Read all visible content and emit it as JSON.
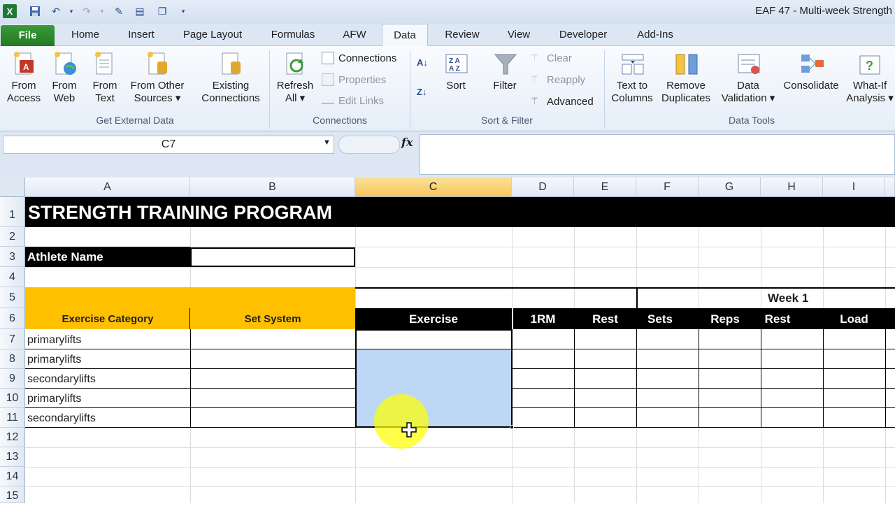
{
  "window": {
    "title": "EAF 47 - Multi-week Strength"
  },
  "tabs": [
    "File",
    "Home",
    "Insert",
    "Page Layout",
    "Formulas",
    "AFW",
    "Data",
    "Review",
    "View",
    "Developer",
    "Add-Ins"
  ],
  "active_tab": "Data",
  "ribbon": {
    "get_external_data": {
      "label": "Get External Data",
      "from_access": [
        "From",
        "Access"
      ],
      "from_web": [
        "From",
        "Web"
      ],
      "from_text": [
        "From",
        "Text"
      ],
      "from_other": [
        "From Other",
        "Sources ▾"
      ],
      "existing": [
        "Existing",
        "Connections"
      ]
    },
    "connections": {
      "label": "Connections",
      "refresh": [
        "Refresh",
        "All ▾"
      ],
      "connections": "Connections",
      "properties": "Properties",
      "edit_links": "Edit Links"
    },
    "sort_filter": {
      "label": "Sort & Filter",
      "sort": "Sort",
      "filter": "Filter",
      "clear": "Clear",
      "reapply": "Reapply",
      "advanced": "Advanced"
    },
    "data_tools": {
      "label": "Data Tools",
      "text_to_columns": [
        "Text to",
        "Columns"
      ],
      "remove_duplicates": [
        "Remove",
        "Duplicates"
      ],
      "data_validation": [
        "Data",
        "Validation ▾"
      ],
      "consolidate": "Consolidate",
      "what_if": [
        "What-If",
        "Analysis ▾"
      ]
    }
  },
  "formula_bar": {
    "name_box": "C7",
    "fx": "fx",
    "value": ""
  },
  "columns": [
    "A",
    "B",
    "C",
    "D",
    "E",
    "F",
    "G",
    "H",
    "I"
  ],
  "selected_column": "C",
  "rows": [
    "1",
    "2",
    "3",
    "4",
    "5",
    "6",
    "7",
    "8",
    "9",
    "10",
    "11",
    "12",
    "13",
    "14",
    "15"
  ],
  "sheet": {
    "title": "STRENGTH TRAINING PROGRAM",
    "athlete_label": "Athlete Name",
    "week_label": "Week 1",
    "headers": [
      "Exercise Category",
      "Set System",
      "Exercise",
      "1RM",
      "Rest",
      "Sets",
      "Reps",
      "Rest",
      "Load"
    ],
    "categories": [
      "primarylifts",
      "primarylifts",
      "secondarylifts",
      "primarylifts",
      "secondarylifts"
    ]
  },
  "colors": {
    "title_bg": "#000000",
    "header_orange": "#ffc000",
    "selection": "#bcd8f6",
    "highlight": "#ffff00"
  }
}
